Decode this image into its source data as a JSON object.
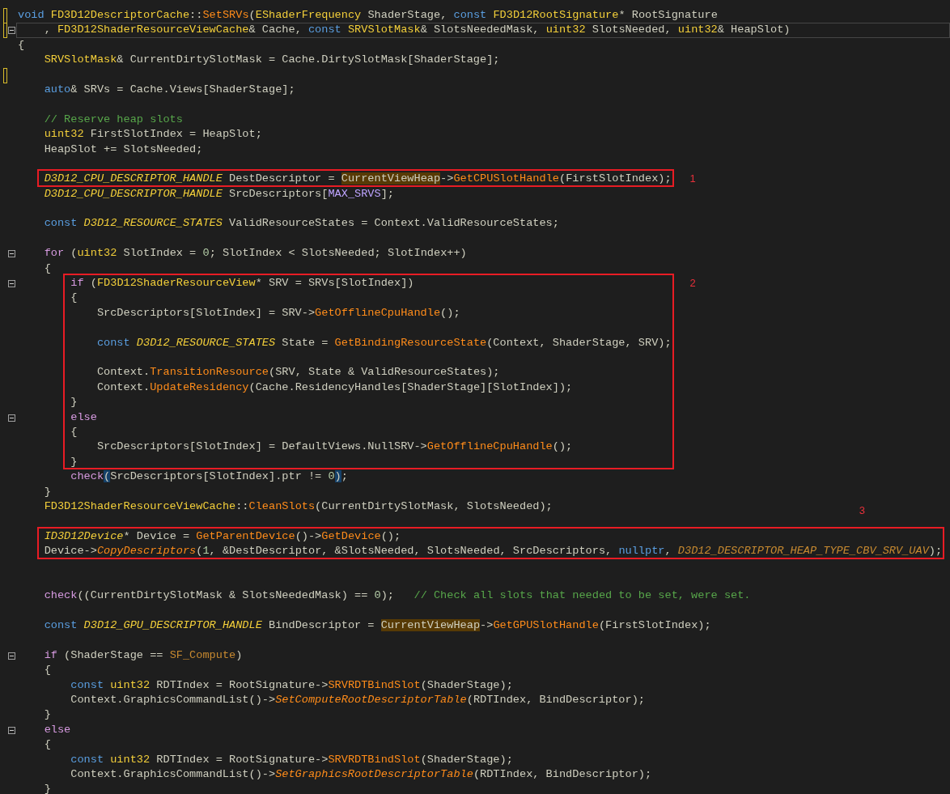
{
  "lines": [
    {
      "changed": true,
      "tokens": [
        {
          "text": "void ",
          "kind": "kw"
        },
        {
          "text": "FD3D12DescriptorCache",
          "kind": "type"
        },
        {
          "text": "::",
          "kind": "plain"
        },
        {
          "text": "SetSRVs",
          "kind": "fn"
        },
        {
          "text": "(",
          "kind": "plain"
        },
        {
          "text": "EShaderFrequency",
          "kind": "type"
        },
        {
          "text": " ShaderStage, ",
          "kind": "plain"
        },
        {
          "text": "const ",
          "kind": "kw"
        },
        {
          "text": "FD3D12RootSignature",
          "kind": "type"
        },
        {
          "text": "* RootSignature",
          "kind": "plain"
        }
      ]
    },
    {
      "changed": true,
      "current": true,
      "expanded": true,
      "tokens": [
        {
          "text": "    , ",
          "kind": "plain"
        },
        {
          "text": "FD3D12ShaderResourceViewCache",
          "kind": "type"
        },
        {
          "text": "& Cache, ",
          "kind": "plain"
        },
        {
          "text": "const ",
          "kind": "kw"
        },
        {
          "text": "SRVSlotMask",
          "kind": "type"
        },
        {
          "text": "& SlotsNeededMask, ",
          "kind": "plain"
        },
        {
          "text": "uint32",
          "kind": "type"
        },
        {
          "text": " SlotsNeeded, ",
          "kind": "plain"
        },
        {
          "text": "uint32",
          "kind": "type"
        },
        {
          "text": "& HeapSlot)",
          "kind": "plain"
        }
      ]
    },
    {
      "tokens": [
        {
          "text": "{",
          "kind": "plain"
        }
      ]
    },
    {
      "tokens": [
        {
          "text": "    SRVSlotMask",
          "kind": "type"
        },
        {
          "text": "& CurrentDirtySlotMask = Cache.DirtySlotMask[ShaderStage];",
          "kind": "plain"
        }
      ]
    },
    {
      "changed": true
    },
    {
      "tokens": [
        {
          "text": "    auto",
          "kind": "kw"
        },
        {
          "text": "& SRVs = Cache.Views[ShaderStage];",
          "kind": "plain"
        }
      ]
    },
    {
      "changed": false
    },
    {
      "tokens": [
        {
          "text": "    // Reserve heap slots",
          "kind": "cmt"
        }
      ]
    },
    {
      "tokens": [
        {
          "text": "    uint32",
          "kind": "type"
        },
        {
          "text": " FirstSlotIndex = HeapSlot;",
          "kind": "plain"
        }
      ]
    },
    {
      "tokens": [
        {
          "text": "    HeapSlot += SlotsNeeded;",
          "kind": "plain"
        }
      ]
    },
    {
      "changed": false
    },
    {
      "framed": true,
      "frame_label": "1",
      "label_above": false,
      "tokens": [
        {
          "text": "    D3D12_CPU_DESCRIPTOR_HANDLE",
          "kind": "itype"
        },
        {
          "text": " DestDescriptor = ",
          "kind": "plain"
        },
        {
          "text": "CurrentViewHeap",
          "kind": "ref"
        },
        {
          "text": "->",
          "kind": "plain"
        },
        {
          "text": "GetCPUSlotHandle",
          "kind": "fn"
        },
        {
          "text": "(FirstSlotIndex);",
          "kind": "plain"
        }
      ]
    },
    {
      "tokens": [
        {
          "text": "    D3D12_CPU_DESCRIPTOR_HANDLE",
          "kind": "itype"
        },
        {
          "text": " SrcDescriptors[",
          "kind": "plain"
        },
        {
          "text": "MAX_SRVS",
          "kind": "macro"
        },
        {
          "text": "];",
          "kind": "plain"
        }
      ]
    },
    {
      "changed": false
    },
    {
      "tokens": [
        {
          "text": "    const ",
          "kind": "kw"
        },
        {
          "text": "D3D12_RESOURCE_STATES",
          "kind": "itype"
        },
        {
          "text": " ValidResourceStates = Context.ValidResourceStates;",
          "kind": "plain"
        }
      ]
    },
    {
      "changed": false
    },
    {
      "expanded": true,
      "tokens": [
        {
          "text": "    for",
          "kind": "ctl"
        },
        {
          "text": " (",
          "kind": "plain"
        },
        {
          "text": "uint32",
          "kind": "type"
        },
        {
          "text": " SlotIndex = ",
          "kind": "plain"
        },
        {
          "text": "0",
          "kind": "num"
        },
        {
          "text": "; SlotIndex < SlotsNeeded; SlotIndex++)",
          "kind": "plain"
        }
      ]
    },
    {
      "tokens": [
        {
          "text": "    {",
          "kind": "plain"
        }
      ]
    },
    {
      "framed": true,
      "frame_label": "2",
      "label_above": false,
      "expanded": true,
      "tokens": [
        {
          "text": "        if",
          "kind": "ctl"
        },
        {
          "text": " (",
          "kind": "plain"
        },
        {
          "text": "FD3D12ShaderResourceView",
          "kind": "type"
        },
        {
          "text": "* SRV = SRVs[SlotIndex])",
          "kind": "plain"
        }
      ]
    },
    {
      "framed": true,
      "tokens": [
        {
          "text": "        {",
          "kind": "plain"
        }
      ]
    },
    {
      "framed": true,
      "tokens": [
        {
          "text": "            SrcDescriptors[SlotIndex] = SRV->",
          "kind": "plain"
        },
        {
          "text": "GetOfflineCpuHandle",
          "kind": "fn"
        },
        {
          "text": "();",
          "kind": "plain"
        }
      ]
    },
    {
      "framed": true
    },
    {
      "framed": true,
      "tokens": [
        {
          "text": "            const ",
          "kind": "kw"
        },
        {
          "text": "D3D12_RESOURCE_STATES",
          "kind": "itype"
        },
        {
          "text": " State = ",
          "kind": "plain"
        },
        {
          "text": "GetBindingResourceState",
          "kind": "fn"
        },
        {
          "text": "(Context, ShaderStage, SRV);",
          "kind": "plain"
        }
      ]
    },
    {
      "framed": true
    },
    {
      "framed": true,
      "tokens": [
        {
          "text": "            Context.",
          "kind": "plain"
        },
        {
          "text": "TransitionResource",
          "kind": "fn"
        },
        {
          "text": "(SRV, State & ValidResourceStates);",
          "kind": "plain"
        }
      ]
    },
    {
      "framed": true,
      "tokens": [
        {
          "text": "            Context.",
          "kind": "plain"
        },
        {
          "text": "UpdateResidency",
          "kind": "fn"
        },
        {
          "text": "(Cache.ResidencyHandles[ShaderStage][SlotIndex]);",
          "kind": "plain"
        }
      ]
    },
    {
      "framed": true,
      "tokens": [
        {
          "text": "        }",
          "kind": "plain"
        }
      ]
    },
    {
      "framed": true,
      "expanded": true,
      "tokens": [
        {
          "text": "        else",
          "kind": "ctl"
        }
      ]
    },
    {
      "framed": true,
      "tokens": [
        {
          "text": "        {",
          "kind": "plain"
        }
      ]
    },
    {
      "framed": true,
      "tokens": [
        {
          "text": "            SrcDescriptors[SlotIndex] = DefaultViews.NullSRV->",
          "kind": "plain"
        },
        {
          "text": "GetOfflineCpuHandle",
          "kind": "fn"
        },
        {
          "text": "();",
          "kind": "plain"
        }
      ]
    },
    {
      "framed": true,
      "tokens": [
        {
          "text": "        }",
          "kind": "plain"
        }
      ]
    },
    {
      "tokens": [
        {
          "text": "        check",
          "kind": "ctl"
        },
        {
          "text": "(",
          "kind": "match"
        },
        {
          "text": "SrcDescriptors[SlotIndex].ptr != ",
          "kind": "plain"
        },
        {
          "text": "0",
          "kind": "num"
        },
        {
          "text": ")",
          "kind": "match"
        },
        {
          "text": ";",
          "kind": "plain"
        }
      ]
    },
    {
      "tokens": [
        {
          "text": "    }",
          "kind": "plain"
        }
      ]
    },
    {
      "tokens": [
        {
          "text": "    FD3D12ShaderResourceViewCache",
          "kind": "type"
        },
        {
          "text": "::",
          "kind": "plain"
        },
        {
          "text": "CleanSlots",
          "kind": "fn"
        },
        {
          "text": "(CurrentDirtySlotMask, SlotsNeeded);",
          "kind": "plain"
        }
      ]
    },
    {
      "changed": false
    },
    {
      "framed": true,
      "frame_label": "3",
      "label_above": true,
      "tokens": [
        {
          "text": "    ID3D12Device",
          "kind": "itype"
        },
        {
          "text": "* Device = ",
          "kind": "plain"
        },
        {
          "text": "GetParentDevice",
          "kind": "fn"
        },
        {
          "text": "()->",
          "kind": "plain"
        },
        {
          "text": "GetDevice",
          "kind": "fn"
        },
        {
          "text": "();",
          "kind": "plain"
        }
      ]
    },
    {
      "framed": true,
      "tokens": [
        {
          "text": "    Device->",
          "kind": "plain"
        },
        {
          "text": "CopyDescriptors",
          "kind": "ifn"
        },
        {
          "text": "(",
          "kind": "plain"
        },
        {
          "text": "1",
          "kind": "num"
        },
        {
          "text": ", &DestDescriptor, &SlotsNeeded, SlotsNeeded, SrcDescriptors, ",
          "kind": "plain"
        },
        {
          "text": "nullptr",
          "kind": "kw"
        },
        {
          "text": ", ",
          "kind": "plain"
        },
        {
          "text": "D3D12_DESCRIPTOR_HEAP_TYPE_CBV_SRV_UAV",
          "kind": "ienum"
        },
        {
          "text": ");",
          "kind": "plain"
        }
      ]
    },
    {
      "changed": false
    },
    {
      "changed": false
    },
    {
      "tokens": [
        {
          "text": "    check",
          "kind": "ctl"
        },
        {
          "text": "((CurrentDirtySlotMask & SlotsNeededMask) == ",
          "kind": "plain"
        },
        {
          "text": "0",
          "kind": "num"
        },
        {
          "text": ");   ",
          "kind": "plain"
        },
        {
          "text": "// Check all slots that needed to be set, were set.",
          "kind": "cmt"
        }
      ]
    },
    {
      "changed": false
    },
    {
      "tokens": [
        {
          "text": "    const ",
          "kind": "kw"
        },
        {
          "text": "D3D12_GPU_DESCRIPTOR_HANDLE",
          "kind": "itype"
        },
        {
          "text": " BindDescriptor = ",
          "kind": "plain"
        },
        {
          "text": "CurrentViewHeap",
          "kind": "ref"
        },
        {
          "text": "->",
          "kind": "plain"
        },
        {
          "text": "GetGPUSlotHandle",
          "kind": "fn"
        },
        {
          "text": "(FirstSlotIndex);",
          "kind": "plain"
        }
      ]
    },
    {
      "changed": false
    },
    {
      "expanded": true,
      "tokens": [
        {
          "text": "    if",
          "kind": "ctl"
        },
        {
          "text": " (ShaderStage == ",
          "kind": "plain"
        },
        {
          "text": "SF_Compute",
          "kind": "enum"
        },
        {
          "text": ")",
          "kind": "plain"
        }
      ]
    },
    {
      "tokens": [
        {
          "text": "    {",
          "kind": "plain"
        }
      ]
    },
    {
      "tokens": [
        {
          "text": "        const ",
          "kind": "kw"
        },
        {
          "text": "uint32",
          "kind": "type"
        },
        {
          "text": " RDTIndex = RootSignature->",
          "kind": "plain"
        },
        {
          "text": "SRVRDTBindSlot",
          "kind": "fn"
        },
        {
          "text": "(ShaderStage);",
          "kind": "plain"
        }
      ]
    },
    {
      "tokens": [
        {
          "text": "        Context.GraphicsCommandList()->",
          "kind": "plain"
        },
        {
          "text": "SetComputeRootDescriptorTable",
          "kind": "ifn"
        },
        {
          "text": "(RDTIndex, BindDescriptor);",
          "kind": "plain"
        }
      ]
    },
    {
      "tokens": [
        {
          "text": "    }",
          "kind": "plain"
        }
      ]
    },
    {
      "expanded": true,
      "tokens": [
        {
          "text": "    else",
          "kind": "ctl"
        }
      ]
    },
    {
      "tokens": [
        {
          "text": "    {",
          "kind": "plain"
        }
      ]
    },
    {
      "tokens": [
        {
          "text": "        const ",
          "kind": "kw"
        },
        {
          "text": "uint32",
          "kind": "type"
        },
        {
          "text": " RDTIndex = RootSignature->",
          "kind": "plain"
        },
        {
          "text": "SRVRDTBindSlot",
          "kind": "fn"
        },
        {
          "text": "(ShaderStage);",
          "kind": "plain"
        }
      ]
    },
    {
      "tokens": [
        {
          "text": "        Context.GraphicsCommandList()->",
          "kind": "plain"
        },
        {
          "text": "SetGraphicsRootDescriptorTable",
          "kind": "ifn"
        },
        {
          "text": "(RDTIndex, BindDescriptor);",
          "kind": "plain"
        }
      ]
    },
    {
      "tokens": [
        {
          "text": "    }",
          "kind": "plain"
        }
      ]
    }
  ]
}
